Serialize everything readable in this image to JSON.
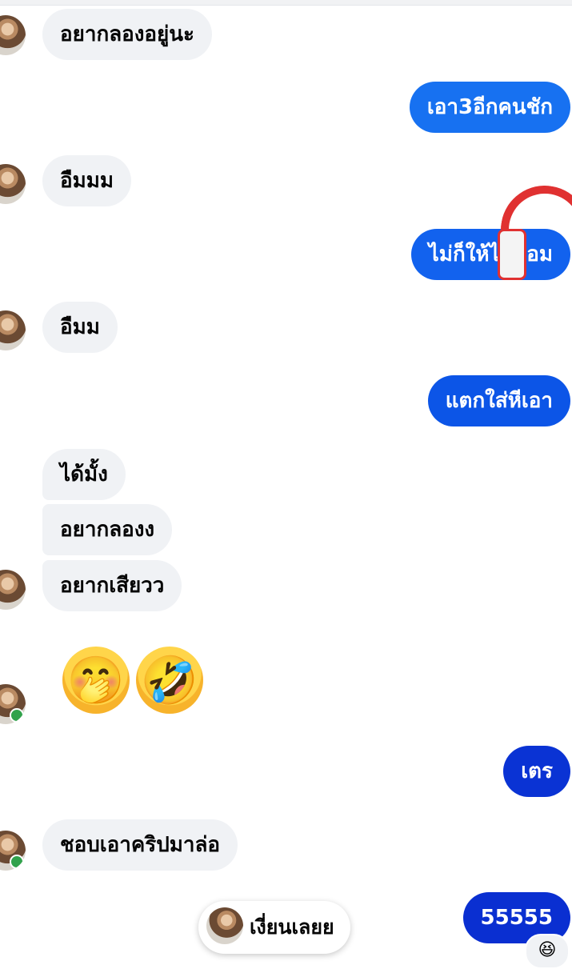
{
  "messages": [
    {
      "side": "in",
      "text": "อยากลองอยู่นะ"
    },
    {
      "side": "out",
      "text": "เอา3อีกคนชัก"
    },
    {
      "side": "in",
      "text": "อืมมม"
    },
    {
      "side": "out",
      "text": "ไม่ก็ให้ได้แอม"
    },
    {
      "side": "in",
      "text": "อืมม"
    },
    {
      "side": "out",
      "text": "แตกใส่หีเอา"
    },
    {
      "side": "in",
      "text": "ได้มั้ง"
    },
    {
      "side": "in",
      "text": "อยากลองง"
    },
    {
      "side": "in",
      "text": "อยากเสียวว"
    },
    {
      "side": "out",
      "text": "เตร"
    },
    {
      "side": "in",
      "text": "ชอบเอาคริปมาล่อ"
    },
    {
      "side": "out",
      "text": "55555"
    }
  ],
  "emojis": [
    "🤭",
    "🤣"
  ],
  "reaction": "😆",
  "pill": {
    "label": "เงี่ยนเลยย"
  },
  "colors": {
    "incoming": "#f0f2f5",
    "outgoing_top": "#1877f2",
    "outgoing_bottom": "#0a2fd1",
    "online": "#31a24c"
  }
}
